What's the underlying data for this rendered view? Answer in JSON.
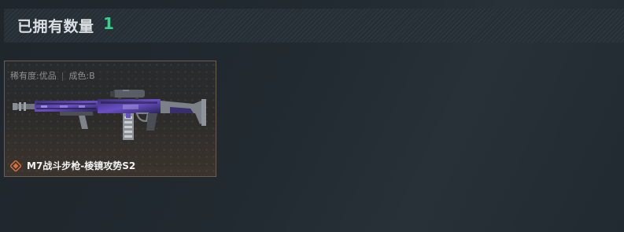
{
  "header": {
    "title": "已拥有数量",
    "count": "1"
  },
  "card": {
    "rarity": "稀有度:优品",
    "condition": "成色:B",
    "name": "M7战斗步枪-棱镜攻势S2",
    "icon": "quality-diamond-icon",
    "weapon_image": "rifle-image"
  },
  "colors": {
    "count_green": "#2ed58a",
    "card_border": "#6b5e4f",
    "quality_orange": "#d9703c"
  }
}
